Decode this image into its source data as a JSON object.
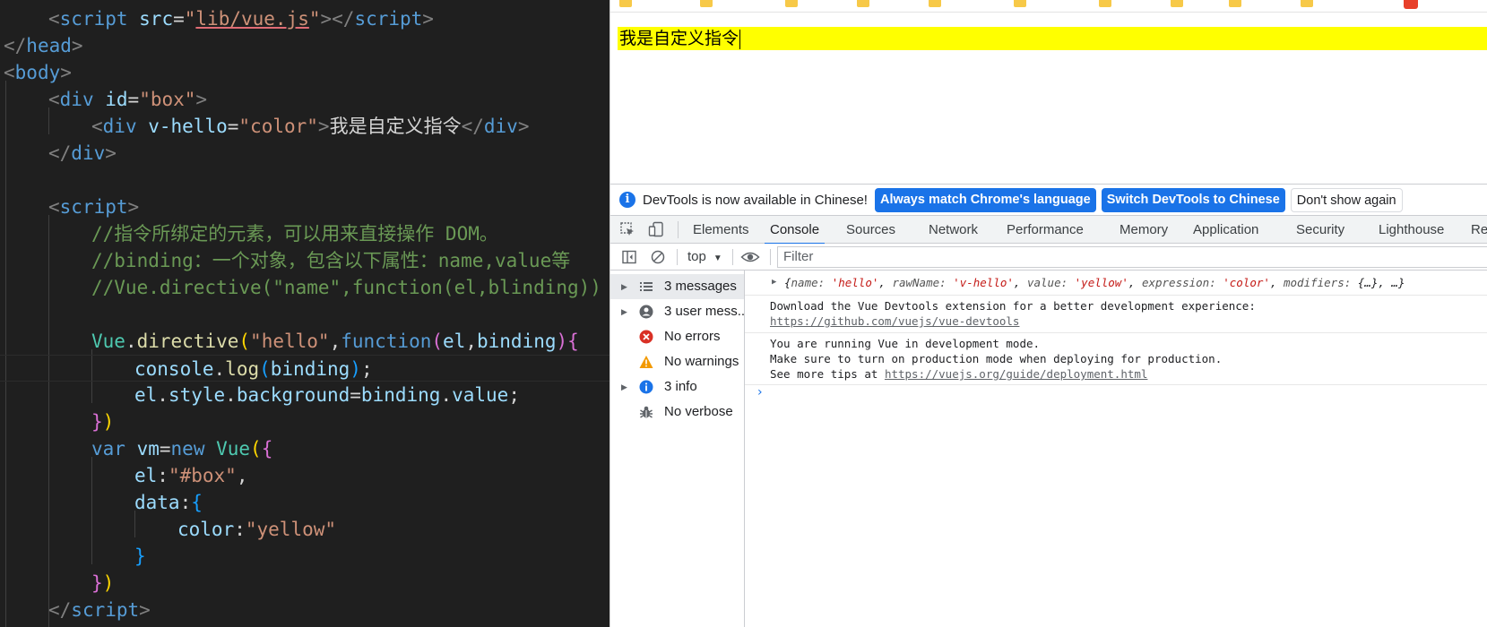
{
  "editor": {
    "lines": {
      "l0_a": "<",
      "l0_b": "script",
      "l0_c": " src",
      "l0_d": "=",
      "l0_e": "\"",
      "l0_f": "lib/vue.js",
      "l0_g": "\"",
      "l0_h": "></",
      "l0_i": "script",
      "l0_j": ">",
      "l1_a": "</",
      "l1_b": "head",
      "l1_c": ">",
      "l2_a": "<",
      "l2_b": "body",
      "l2_c": ">",
      "l3_a": "<",
      "l3_b": "div",
      "l3_c": " id",
      "l3_d": "=",
      "l3_e": "\"box\"",
      "l3_f": ">",
      "l4_a": "<",
      "l4_b": "div",
      "l4_c": " v-hello",
      "l4_d": "=",
      "l4_e": "\"color\"",
      "l4_f": ">",
      "l4_g": "我是自定义指令",
      "l4_h": "</",
      "l4_i": "div",
      "l4_j": ">",
      "l5_a": "</",
      "l5_b": "div",
      "l5_c": ">",
      "l7_a": "<",
      "l7_b": "script",
      "l7_c": ">",
      "l8": "//指令所绑定的元素，可以用来直接操作 DOM。",
      "l9": "//binding：一个对象，包含以下属性：name,value等",
      "l10": "//Vue.directive(\"name\",function(el,blinding))",
      "l12_a": "Vue",
      "l12_b": ".",
      "l12_c": "directive",
      "l12_d": "(",
      "l12_e": "\"hello\"",
      "l12_f": ",",
      "l12_g": "function",
      "l12_h": "(",
      "l12_i": "el",
      "l12_j": ",",
      "l12_k": "binding",
      "l12_l": ")",
      "l12_m": "{",
      "l13_a": "console",
      "l13_b": ".",
      "l13_c": "log",
      "l13_d": "(",
      "l13_e": "binding",
      "l13_f": ")",
      "l13_g": ";",
      "l14_a": "el",
      "l14_b": ".",
      "l14_c": "style",
      "l14_d": ".",
      "l14_e": "background",
      "l14_f": "=",
      "l14_g": "binding",
      "l14_h": ".",
      "l14_i": "value",
      "l14_j": ";",
      "l15_a": "}",
      "l15_b": ")",
      "l16_a": "var",
      "l16_b": " vm",
      "l16_c": "=",
      "l16_d": "new",
      "l16_e": " Vue",
      "l16_f": "(",
      "l16_g": "{",
      "l17_a": "el",
      "l17_b": ":",
      "l17_c": "\"#box\"",
      "l17_d": ",",
      "l18_a": "data",
      "l18_b": ":",
      "l18_c": "{",
      "l19_a": "color",
      "l19_b": ":",
      "l19_c": "\"yellow\"",
      "l20": "}",
      "l21_a": "}",
      "l21_b": ")",
      "l22_a": "</",
      "l22_b": "script",
      "l22_c": ">"
    }
  },
  "browser": {
    "page_text": "我是自定义指令",
    "page_bg_color": "#ffff00"
  },
  "devtools": {
    "infobar": {
      "text": "DevTools is now available in Chinese!",
      "btn_match": "Always match Chrome's language",
      "btn_switch": "Switch DevTools to Chinese",
      "btn_dismiss": "Don't show again"
    },
    "tabs": [
      "Elements",
      "Console",
      "Sources",
      "Network",
      "Performance",
      "Memory",
      "Application",
      "Security",
      "Lighthouse",
      "Recor"
    ],
    "active_tab": "Console",
    "toolbar": {
      "context": "top",
      "filter_placeholder": "Filter"
    },
    "sidebar": [
      {
        "label": "3 messages",
        "icon": "list-icon"
      },
      {
        "label": "3 user mess...",
        "icon": "user-icon"
      },
      {
        "label": "No errors",
        "icon": "error-icon"
      },
      {
        "label": "No warnings",
        "icon": "warning-icon"
      },
      {
        "label": "3 info",
        "icon": "info-icon"
      },
      {
        "label": "No verbose",
        "icon": "bug-icon"
      }
    ],
    "console": {
      "obj_open": "{",
      "k1": "name: ",
      "v1": "'hello'",
      "c1": ", ",
      "k2": "rawName: ",
      "v2": "'v-hello'",
      "c2": ", ",
      "k3": "value: ",
      "v3": "'yellow'",
      "c3": ", ",
      "k4": "expression: ",
      "v4": "'color'",
      "c4": ", ",
      "k5": "modifiers: ",
      "v5": "{…}",
      "c5": ", …}",
      "m2_line1": "Download the Vue Devtools extension for a better development experience:",
      "m2_link": "https://github.com/vuejs/vue-devtools",
      "m3_line1": "You are running Vue in development mode.",
      "m3_line2": "Make sure to turn on production mode when deploying for production.",
      "m3_line3_prefix": "See more tips at ",
      "m3_link": "https://vuejs.org/guide/deployment.html",
      "prompt": "›"
    }
  }
}
